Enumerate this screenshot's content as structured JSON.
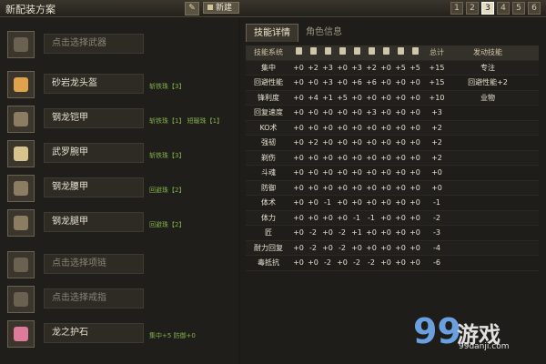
{
  "header": {
    "title": "新配装方案",
    "new_label": "新建",
    "pages": [
      "1",
      "2",
      "3",
      "4",
      "5",
      "6"
    ],
    "active_page": "3"
  },
  "slots": [
    {
      "name": "点击选择武器",
      "empty": true,
      "note": "",
      "icon": "weapon-icon",
      "color": "#6a6150"
    },
    {
      "name": "砂岩龙头盔",
      "empty": false,
      "note": "斩铁珠【3】",
      "icon": "helmet-icon",
      "color": "#e0a24a"
    },
    {
      "name": "钢龙铠甲",
      "empty": false,
      "note": "斩铁珠【1】 短暖珠【1】",
      "icon": "chest-armor-icon",
      "color": "#8c7c62"
    },
    {
      "name": "武罗腕甲",
      "empty": false,
      "note": "斩铁珠【3】",
      "icon": "arm-armor-icon",
      "color": "#d8c48a"
    },
    {
      "name": "钢龙腰甲",
      "empty": false,
      "note": "回避珠【2】",
      "icon": "waist-armor-icon",
      "color": "#8c7c62"
    },
    {
      "name": "钢龙腿甲",
      "empty": false,
      "note": "回避珠【2】",
      "icon": "leg-armor-icon",
      "color": "#8c7c62"
    },
    {
      "name": "点击选择项链",
      "empty": true,
      "note": "",
      "icon": "necklace-icon",
      "color": "#6a6150"
    },
    {
      "name": "点击选择戒指",
      "empty": true,
      "note": "",
      "icon": "ring-icon",
      "color": "#6a6150"
    },
    {
      "name": "龙之护石",
      "empty": false,
      "note": "集中+5 防御+0",
      "icon": "charm-icon",
      "color": "#e07a9a"
    }
  ],
  "tabs": [
    {
      "label": "技能详情",
      "active": true
    },
    {
      "label": "角色信息",
      "active": false
    }
  ],
  "table": {
    "headers": {
      "skill": "技能系统",
      "total": "总计",
      "active": "发动技能"
    },
    "column_icons": [
      "weapon-icon",
      "helmet-icon",
      "chest-armor-icon",
      "arm-armor-icon",
      "waist-armor-icon",
      "leg-armor-icon",
      "necklace-icon",
      "ring-icon",
      "charm-icon"
    ],
    "rows": [
      {
        "skill": "集中",
        "vals": [
          "+0",
          "+2",
          "+3",
          "+0",
          "+3",
          "+2",
          "+0",
          "+5",
          "+5"
        ],
        "total": "+15",
        "active": "专注"
      },
      {
        "skill": "回避性能",
        "vals": [
          "+0",
          "+0",
          "+3",
          "+0",
          "+6",
          "+6",
          "+0",
          "+0",
          "+0"
        ],
        "total": "+15",
        "active": "回避性能+2"
      },
      {
        "skill": "锋利度",
        "vals": [
          "+0",
          "+4",
          "+1",
          "+5",
          "+0",
          "+0",
          "+0",
          "+0",
          "+0"
        ],
        "total": "+10",
        "active": "业物"
      },
      {
        "skill": "回复速度",
        "vals": [
          "+0",
          "+0",
          "+0",
          "+0",
          "+0",
          "+3",
          "+0",
          "+0",
          "+0"
        ],
        "total": "+3",
        "active": ""
      },
      {
        "skill": "KO术",
        "vals": [
          "+0",
          "+0",
          "+0",
          "+0",
          "+0",
          "+0",
          "+0",
          "+0",
          "+0"
        ],
        "total": "+2",
        "active": ""
      },
      {
        "skill": "强韧",
        "vals": [
          "+0",
          "+2",
          "+0",
          "+0",
          "+0",
          "+0",
          "+0",
          "+0",
          "+0"
        ],
        "total": "+2",
        "active": ""
      },
      {
        "skill": "剃伤",
        "vals": [
          "+0",
          "+0",
          "+0",
          "+0",
          "+0",
          "+0",
          "+0",
          "+0",
          "+0"
        ],
        "total": "+2",
        "active": ""
      },
      {
        "skill": "斗魂",
        "vals": [
          "+0",
          "+0",
          "+0",
          "+0",
          "+0",
          "+0",
          "+0",
          "+0",
          "+0"
        ],
        "total": "+0",
        "active": ""
      },
      {
        "skill": "防御",
        "vals": [
          "+0",
          "+0",
          "+0",
          "+0",
          "+0",
          "+0",
          "+0",
          "+0",
          "+0"
        ],
        "total": "+0",
        "active": ""
      },
      {
        "skill": "体术",
        "vals": [
          "+0",
          "+0",
          "-1",
          "+0",
          "+0",
          "+0",
          "+0",
          "+0",
          "+0"
        ],
        "total": "-1",
        "active": ""
      },
      {
        "skill": "体力",
        "vals": [
          "+0",
          "+0",
          "+0",
          "+0",
          "-1",
          "-1",
          "+0",
          "+0",
          "+0"
        ],
        "total": "-2",
        "active": ""
      },
      {
        "skill": "匠",
        "vals": [
          "+0",
          "-2",
          "+0",
          "-2",
          "+1",
          "+0",
          "+0",
          "+0",
          "+0"
        ],
        "total": "-3",
        "active": ""
      },
      {
        "skill": "耐力回复",
        "vals": [
          "+0",
          "-2",
          "+0",
          "-2",
          "+0",
          "+0",
          "+0",
          "+0",
          "+0"
        ],
        "total": "-4",
        "active": ""
      },
      {
        "skill": "毒抵抗",
        "vals": [
          "+0",
          "+0",
          "-2",
          "+0",
          "-2",
          "-2",
          "+0",
          "+0",
          "+0"
        ],
        "total": "-6",
        "active": ""
      }
    ]
  },
  "watermark": {
    "brand": "游戏",
    "url": "99danji.com"
  }
}
